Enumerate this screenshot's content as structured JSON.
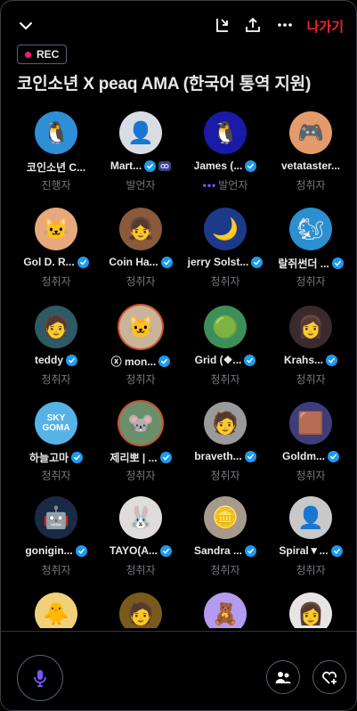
{
  "header": {
    "leave_label": "나가기",
    "rec_label": "REC",
    "title": "코인소년 X peaq AMA (한국어 통역 지원)"
  },
  "colors": {
    "accent": "#1d9bf0",
    "leave": "#f4212e",
    "rec_dot": "#f91880",
    "speaking_dots": "#7856ff"
  },
  "participants": [
    {
      "name": "코인소년 C...",
      "role": "진행자",
      "badge": "none",
      "avatar": "#2f8fd6",
      "glyph": "🐧",
      "ring": false
    },
    {
      "name": "Mart...",
      "role": "발언자",
      "badge": "both",
      "avatar": "#d9dde3",
      "glyph": "👤",
      "ring": false
    },
    {
      "name": "James (...",
      "role": "발언자",
      "badge": "blue",
      "avatar": "#1a1aa8",
      "glyph": "🐧",
      "ring": false,
      "speaking": "•••"
    },
    {
      "name": "vetataster...",
      "role": "청취자",
      "badge": "none",
      "avatar": "#e49a6b",
      "glyph": "🎮",
      "ring": false
    },
    {
      "name": "Gol D. R...",
      "role": "청취자",
      "badge": "blue",
      "avatar": "#e6a87c",
      "glyph": "🐱",
      "ring": false
    },
    {
      "name": "Coin Ha...",
      "role": "청취자",
      "badge": "blue",
      "avatar": "#8a5a3a",
      "glyph": "👧",
      "ring": false
    },
    {
      "name": "jerry Solst...",
      "role": "청취자",
      "badge": "blue",
      "avatar": "#1c3a8a",
      "glyph": "🌙",
      "ring": false
    },
    {
      "name": "랄쥐썬더 ...",
      "role": "청취자",
      "badge": "blue",
      "avatar": "#2b8fd0",
      "glyph": "🐿",
      "ring": false
    },
    {
      "name": "teddy",
      "role": "청취자",
      "badge": "blue",
      "avatar": "#2d5a63",
      "glyph": "🧑",
      "ring": false
    },
    {
      "name": "ⓧ mon...",
      "role": "청취자",
      "badge": "blue",
      "avatar": "#c9b49a",
      "glyph": "🐱",
      "ring": true
    },
    {
      "name": "Grid (❖...",
      "role": "청취자",
      "badge": "blue",
      "avatar": "#3d8f5a",
      "glyph": "🟢",
      "ring": false
    },
    {
      "name": "Krahs...",
      "role": "청취자",
      "badge": "blue",
      "avatar": "#3a2a2e",
      "glyph": "👩",
      "ring": false
    },
    {
      "name": "하늘고마",
      "role": "청취자",
      "badge": "blue",
      "avatar": "#56b3e8",
      "glyph": "SKY GOMA",
      "ring": false
    },
    {
      "name": "제리뽀 | ...",
      "role": "청취자",
      "badge": "blue",
      "avatar": "#6a8f6a",
      "glyph": "🐭",
      "ring": true
    },
    {
      "name": "braveth...",
      "role": "청취자",
      "badge": "blue",
      "avatar": "#9a9a9a",
      "glyph": "🧑",
      "ring": false
    },
    {
      "name": "Goldm...",
      "role": "청취자",
      "badge": "blue",
      "avatar": "#3e3c7a",
      "glyph": "🟫",
      "ring": false
    },
    {
      "name": "gonigin...",
      "role": "청취자",
      "badge": "blue",
      "avatar": "#1b2a44",
      "glyph": "🤖",
      "ring": false
    },
    {
      "name": "TAYO(A...",
      "role": "청취자",
      "badge": "blue",
      "avatar": "#e0dcdc",
      "glyph": "🐰",
      "ring": false
    },
    {
      "name": "Sandra ...",
      "role": "청취자",
      "badge": "blue",
      "avatar": "#a69a8c",
      "glyph": "🪙",
      "ring": false
    },
    {
      "name": "Spiral▼...",
      "role": "청취자",
      "badge": "blue",
      "avatar": "#c8c8c8",
      "glyph": "👤",
      "ring": false
    },
    {
      "name": "",
      "role": "",
      "badge": "none",
      "avatar": "#f1d07a",
      "glyph": "🐥",
      "ring": false
    },
    {
      "name": "",
      "role": "",
      "badge": "none",
      "avatar": "#7a5a1a",
      "glyph": "🧑",
      "ring": false
    },
    {
      "name": "",
      "role": "",
      "badge": "none",
      "avatar": "#b49bf0",
      "glyph": "🧸",
      "ring": false
    },
    {
      "name": "",
      "role": "",
      "badge": "none",
      "avatar": "#e8e4e4",
      "glyph": "👩",
      "ring": false
    }
  ]
}
